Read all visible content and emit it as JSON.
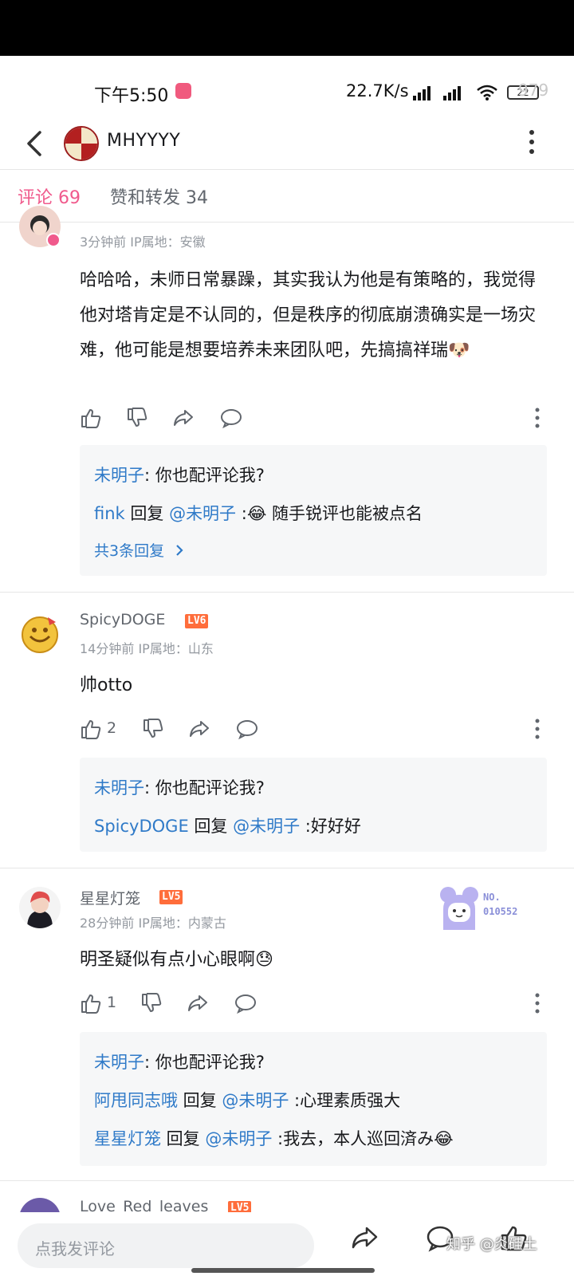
{
  "status_bar": {
    "time": "下午5:50",
    "network_speed": "22.7K/s",
    "battery": "22",
    "overlay_number": "979"
  },
  "nav": {
    "title": "MHYYYY",
    "icons": [
      "back-icon",
      "more-icon"
    ]
  },
  "tabs": [
    {
      "label": "评论 69",
      "active": true
    },
    {
      "label": "赞和转发 34",
      "active": false
    }
  ],
  "comments": [
    {
      "meta": "3分钟前  IP属地：安徽",
      "text": "哈哈哈，未师日常暴躁，其实我认为他是有策略的，我觉得他对塔肯定是不认同的，但是秩序的彻底崩溃确实是一场灾难，他可能是想要培养未来团队吧，先搞搞祥瑞",
      "emoji": "🐶",
      "likes": "",
      "replies": [
        {
          "user": "未明子",
          "sep": ": ",
          "text": "你也配评论我?"
        },
        {
          "user": "fink",
          "reply_word": " 回复 ",
          "target": "@未明子",
          "sep": " :",
          "emoji": "😂",
          "text": " 随手锐评也能被点名"
        }
      ],
      "more_replies": "共3条回复"
    },
    {
      "name": "SpicyDOGE",
      "level": "LV6",
      "meta": "14分钟前  IP属地：山东",
      "text": "帅otto",
      "likes": "2",
      "replies": [
        {
          "user": "未明子",
          "sep": ": ",
          "text": "你也配评论我?"
        },
        {
          "user": "SpicyDOGE",
          "reply_word": " 回复 ",
          "target": "@未明子",
          "sep": " :",
          "text": "好好好"
        }
      ]
    },
    {
      "name": "星星灯笼",
      "level": "LV5",
      "meta": "28分钟前  IP属地：内蒙古",
      "text": "明圣疑似有点小心眼啊",
      "emoji": "😓",
      "likes": "1",
      "badge_number": "NO.\n010552",
      "replies": [
        {
          "user": "未明子",
          "sep": ": ",
          "text": "你也配评论我?"
        },
        {
          "user": "阿甩同志哦",
          "reply_word": " 回复 ",
          "target": "@未明子",
          "sep": " :",
          "text": "心理素质强大"
        },
        {
          "user": "星星灯笼",
          "reply_word": " 回复 ",
          "target": "@未明子",
          "sep": " :",
          "text": "我去，本人巡回済み",
          "emoji": "😂"
        }
      ]
    },
    {
      "name": "Love_Red_leaves",
      "level": "LV5"
    }
  ],
  "bottom_bar": {
    "input_placeholder": "点我发评论",
    "watermark": "知乎 @炎硅土"
  },
  "colors": {
    "accent_pink": "#f05a8c",
    "link_blue": "#2f7ac8",
    "level_orange": "#ff6d3b"
  }
}
